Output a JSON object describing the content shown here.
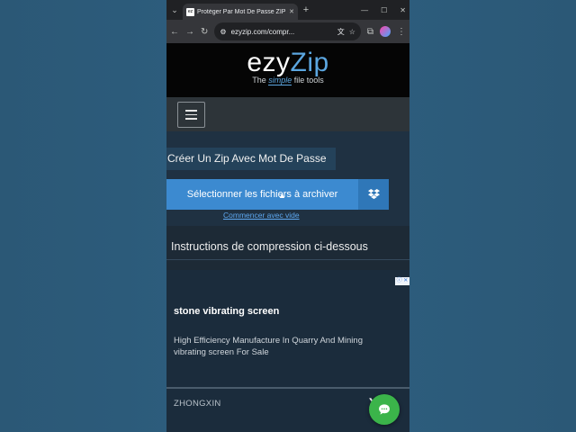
{
  "browser": {
    "tab_title": "Protéger Par Mot De Passe ZIP",
    "favicon_text": "ez",
    "url": "ezyzip.com/compr...",
    "tab_close": "✕",
    "new_tab": "+"
  },
  "header": {
    "logo_ezy": "ezy",
    "logo_zip": "Zip",
    "tagline_pre": "The ",
    "tagline_simple": "simple",
    "tagline_post": " file tools"
  },
  "tool": {
    "heading": "Créer Un Zip Avec Mot De Passe",
    "select_label": "Sélectionner les fichiers à archiver",
    "start_empty": "Commencer avec vide"
  },
  "instructions": {
    "label": "Instructions de compression ci-dessous"
  },
  "ad": {
    "choices": "ⓘ ✕",
    "title": "stone vibrating screen",
    "description": "High Efficiency Manufacture In Quarry And Mining vibrating screen For Sale",
    "brand": "ZHONGXIN",
    "arrow": "❯"
  },
  "colors": {
    "accent": "#3c8ad0",
    "logo_blue": "#5ba6e0",
    "chat_green": "#3bb44a"
  }
}
